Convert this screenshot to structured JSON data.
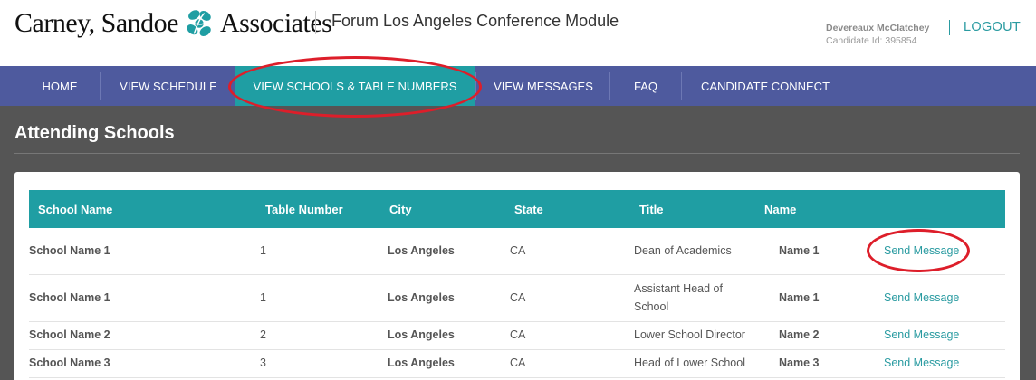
{
  "header": {
    "logo_text_left": "Carney, Sandoe",
    "logo_text_right": "Associates",
    "module_title": "Forum Los Angeles Conference Module",
    "user_name": "Devereaux McClatchey",
    "candidate_id": "Candidate Id: 395854",
    "logout_label": "LOGOUT",
    "accent_color": "#2a9ba1"
  },
  "nav": {
    "background": "#4e5a9e",
    "active_background": "#1f9ea3",
    "items": [
      {
        "label": "HOME"
      },
      {
        "label": "VIEW SCHEDULE"
      },
      {
        "label": "VIEW SCHOOLS & TABLE NUMBERS",
        "active": true
      },
      {
        "label": "VIEW MESSAGES"
      },
      {
        "label": "FAQ"
      },
      {
        "label": "CANDIDATE CONNECT"
      }
    ]
  },
  "main": {
    "heading": "Attending Schools",
    "table": {
      "columns": [
        "School Name",
        "Table Number",
        "City",
        "State",
        "Title",
        "Name"
      ],
      "rows": [
        {
          "school": "School Name 1",
          "table": "1",
          "city": "Los Angeles",
          "state": "CA",
          "title": "Dean of Academics",
          "name": "Name 1",
          "action": "Send Message"
        },
        {
          "school": "School Name 1",
          "table": "1",
          "city": "Los Angeles",
          "state": "CA",
          "title": "Assistant Head of School",
          "name": "Name 1",
          "action": "Send Message"
        },
        {
          "school": "School Name 2",
          "table": "2",
          "city": "Los Angeles",
          "state": "CA",
          "title": "Lower School Director",
          "name": "Name 2",
          "action": "Send Message"
        },
        {
          "school": "School Name 3",
          "table": "3",
          "city": "Los Angeles",
          "state": "CA",
          "title": "Head of Lower School",
          "name": "Name 3",
          "action": "Send Message"
        }
      ]
    }
  },
  "annotations": {
    "highlight_color": "#dd1e2a"
  }
}
